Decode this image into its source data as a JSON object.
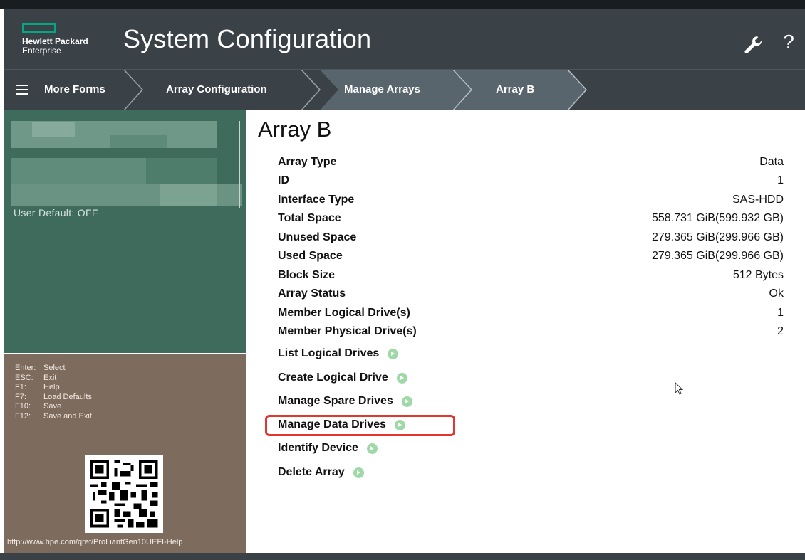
{
  "header": {
    "brand_line1": "Hewlett Packard",
    "brand_line2": "Enterprise",
    "title": "System Configuration",
    "help_label": "?"
  },
  "nav": {
    "menu_label": "More Forms",
    "breadcrumbs": [
      "Array Configuration",
      "Manage Arrays",
      "Array B"
    ]
  },
  "sidebar": {
    "description_text": "User Default: OFF",
    "keys": [
      {
        "key": "Enter:",
        "action": "Select"
      },
      {
        "key": "ESC:",
        "action": "Exit"
      },
      {
        "key": "F1:",
        "action": "Help"
      },
      {
        "key": "F7:",
        "action": "Load Defaults"
      },
      {
        "key": "F10:",
        "action": "Save"
      },
      {
        "key": "F12:",
        "action": "Save and Exit"
      }
    ],
    "help_url": "http://www.hpe.com/qref/ProLiantGen10UEFI-Help"
  },
  "main": {
    "title": "Array B",
    "properties": [
      {
        "label": "Array Type",
        "value": "Data"
      },
      {
        "label": "ID",
        "value": "1"
      },
      {
        "label": "Interface Type",
        "value": "SAS-HDD"
      },
      {
        "label": "Total Space",
        "value": "558.731 GiB(599.932 GB)"
      },
      {
        "label": "Unused Space",
        "value": "279.365 GiB(299.966 GB)"
      },
      {
        "label": "Used Space",
        "value": "279.365 GiB(299.966 GB)"
      },
      {
        "label": "Block Size",
        "value": "512 Bytes"
      },
      {
        "label": "Array Status",
        "value": "Ok"
      },
      {
        "label": "Member Logical Drive(s)",
        "value": "1"
      },
      {
        "label": "Member Physical Drive(s)",
        "value": "2"
      }
    ],
    "actions": [
      {
        "label": "List Logical Drives"
      },
      {
        "label": "Create Logical Drive"
      },
      {
        "label": "Manage Spare Drives"
      },
      {
        "label": "Manage Data Drives"
      },
      {
        "label": "Identify Device"
      },
      {
        "label": "Delete Array"
      }
    ]
  },
  "colors": {
    "brand_green": "#01a982",
    "header_bg": "#3a4248",
    "sidebar_green": "#3f6b5c",
    "sidebar_brown": "#7d6b5e",
    "highlight_red": "#e5362e",
    "link_dot": "#9fd9a7"
  },
  "icons": {
    "settings": "wrench-icon",
    "help": "help-icon",
    "menu": "hamburger-icon",
    "action": "arrow-circle-icon",
    "pointer": "mouse-cursor-icon"
  }
}
